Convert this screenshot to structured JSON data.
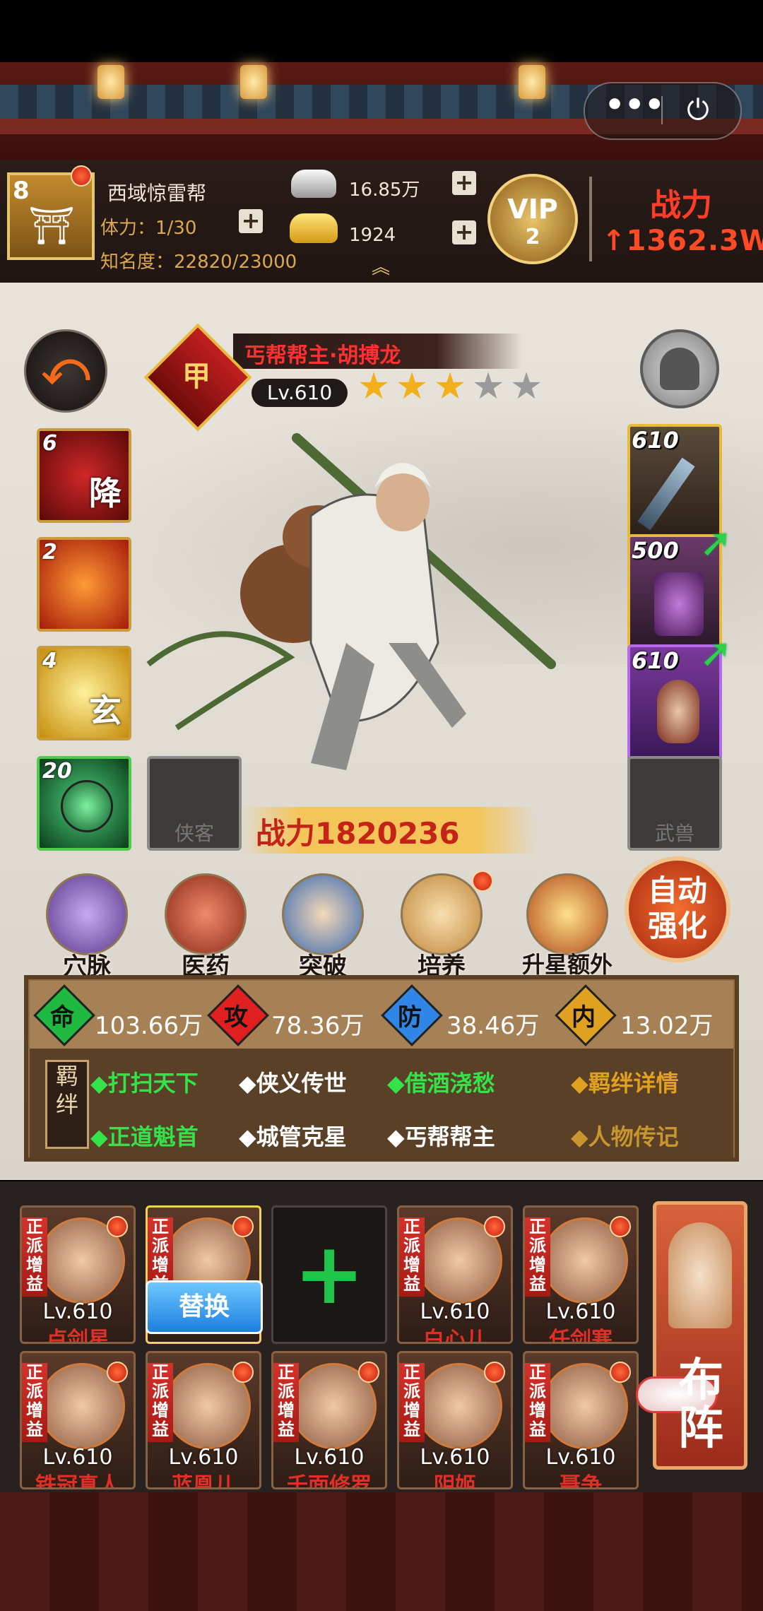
{
  "window": {
    "more_icon": "more-dots",
    "close_icon": "power"
  },
  "player": {
    "level": "8",
    "guild_name": "西域惊雷帮",
    "stamina": "体力：1/30",
    "fame": "知名度：22820/23000",
    "silver": "16.85万",
    "gold": "1924",
    "vip_label": "VIP",
    "vip_level": "2",
    "power_label": "战力",
    "power_value": "1362.3W"
  },
  "hero": {
    "rank": "甲",
    "name": "丐帮帮主·胡搏龙",
    "level": "Lv.610",
    "stars_filled": 3,
    "stars_total": 5,
    "combat_label": "战力",
    "combat_value": "1820236"
  },
  "skills": [
    {
      "count": "6",
      "glyph": "降",
      "color": "#8e1010"
    },
    {
      "count": "2",
      "glyph": "",
      "color": "#c43012"
    },
    {
      "count": "4",
      "glyph": "玄",
      "color": "#c59312"
    },
    {
      "count": "20",
      "glyph": "",
      "color": "#1f6b2f"
    }
  ],
  "slots": {
    "xiake": "侠客",
    "wushou": "武兽"
  },
  "equipment": [
    {
      "count": "610",
      "color": "#d9a63a"
    },
    {
      "count": "500",
      "color": "#d9a63a"
    },
    {
      "count": "610",
      "color": "#8e3ad8"
    }
  ],
  "functions": [
    {
      "label": "穴脉"
    },
    {
      "label": "医药"
    },
    {
      "label": "突破"
    },
    {
      "label": "培养"
    },
    {
      "label": "升星额外"
    }
  ],
  "auto_strengthen": "自动强化",
  "stats": [
    {
      "label": "命",
      "value": "103.66万",
      "color": "#1fb840"
    },
    {
      "label": "攻",
      "value": "78.36万",
      "color": "#e02020"
    },
    {
      "label": "防",
      "value": "38.46万",
      "color": "#2f86e6"
    },
    {
      "label": "内",
      "value": "13.02万",
      "color": "#e0a020"
    }
  ],
  "bonds": {
    "tag": "羁绊",
    "row1": [
      {
        "text": "◆打扫天下",
        "color": "#34e34a"
      },
      {
        "text": "◆侠义传世",
        "color": "#ffffff"
      },
      {
        "text": "◆借酒浇愁",
        "color": "#34e34a"
      }
    ],
    "row2": [
      {
        "text": "◆正道魁首",
        "color": "#34e34a"
      },
      {
        "text": "◆城管克星",
        "color": "#ffffff"
      },
      {
        "text": "◆丐帮帮主",
        "color": "#ffffff"
      }
    ],
    "detail": "◆羁绊详情",
    "biography": "◆人物传记"
  },
  "team": {
    "tag": "正派增益",
    "replace": "替换",
    "row1": [
      {
        "level": "Lv.610",
        "name": "卢剑星"
      },
      {
        "level": "",
        "name": ""
      },
      {
        "level": "",
        "name": ""
      },
      {
        "level": "Lv.610",
        "name": "白心儿"
      },
      {
        "level": "Lv.610",
        "name": "任剑寒"
      }
    ],
    "row2": [
      {
        "level": "Lv.610",
        "name": "铁冠真人"
      },
      {
        "level": "Lv.610",
        "name": "蓝凰儿"
      },
      {
        "level": "Lv.610",
        "name": "千面修罗"
      },
      {
        "level": "Lv.610",
        "name": "阴姬"
      },
      {
        "level": "Lv.610",
        "name": "聂争"
      }
    ],
    "add_symbol": "+",
    "formation": "布阵"
  }
}
